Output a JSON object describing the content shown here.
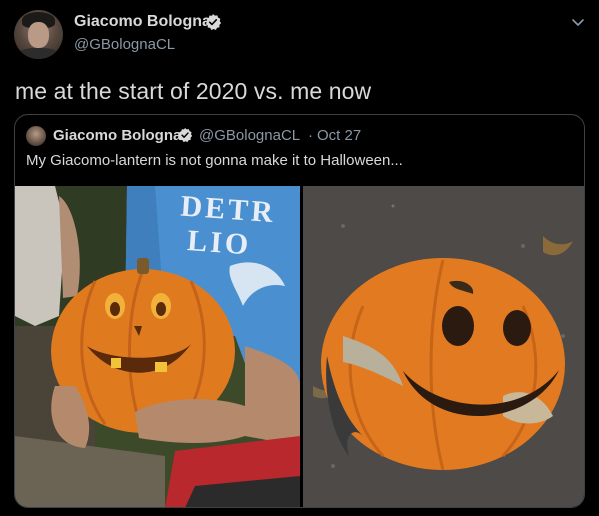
{
  "tweet": {
    "author_name": "Giacomo Bologna",
    "author_handle": "@GBolognaCL",
    "text": "me at the start of 2020 vs. me now"
  },
  "quoted_tweet": {
    "author_name": "Giacomo Bologna",
    "author_handle": "@GBolognaCL",
    "separator": "·",
    "date": "Oct 27",
    "text": "My Giacomo-lantern is not gonna make it to Halloween..."
  },
  "photo_text": {
    "shirt_text_line1": "DETR",
    "shirt_text_line2": "LIO"
  },
  "colors": {
    "background": "#000000",
    "text_primary": "#d9d9d9",
    "text_secondary": "#8b98a5",
    "verified_badge": "#d9d9d9",
    "card_border": "#3d4248",
    "pumpkin": "#e07a1f",
    "shirt_blue": "#4a8fd0"
  },
  "icons": {
    "verified": "verified-badge-icon",
    "menu": "chevron-down-icon"
  }
}
